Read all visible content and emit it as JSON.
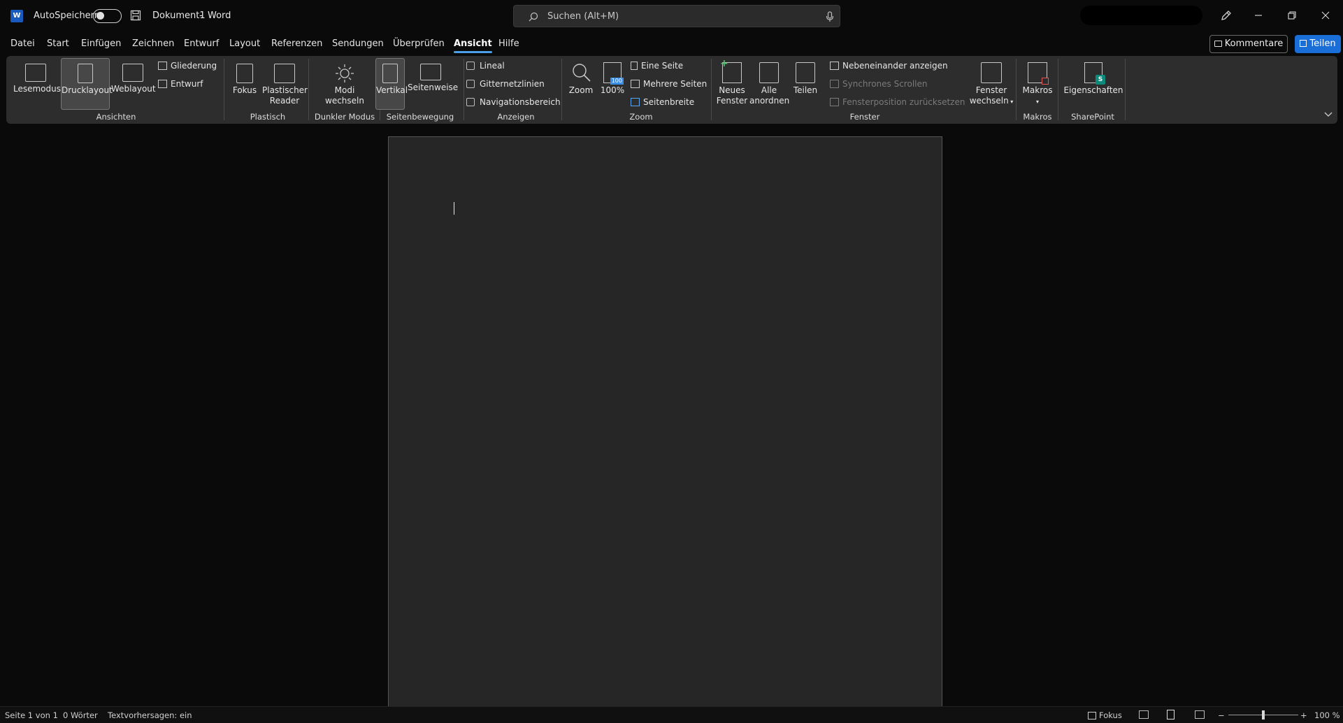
{
  "titlebar": {
    "autosave_label": "AutoSpeichern",
    "document_title": "Dokument1",
    "separator": "-",
    "app_name": "Word",
    "search_placeholder": "Suchen (Alt+M)",
    "app_icon_letter": "W"
  },
  "menu": {
    "items": [
      "Datei",
      "Start",
      "Einfügen",
      "Zeichnen",
      "Entwurf",
      "Layout",
      "Referenzen",
      "Sendungen",
      "Überprüfen",
      "Ansicht",
      "Hilfe"
    ],
    "active": "Ansicht",
    "comments_label": "Kommentare",
    "share_label": "Teilen"
  },
  "ribbon": {
    "ansichten": {
      "group": "Ansichten",
      "lesemodus": "Lesemodus",
      "drucklayout": "Drucklayout",
      "weblayout": "Weblayout",
      "gliederung": "Gliederung",
      "entwurf": "Entwurf"
    },
    "plastisch": {
      "group": "Plastisch",
      "fokus": "Fokus",
      "reader_line1": "Plastischer",
      "reader_line2": "Reader"
    },
    "dunkler": {
      "group": "Dunkler Modus",
      "line1": "Modi",
      "line2": "wechseln"
    },
    "seitenbewegung": {
      "group": "Seitenbewegung",
      "vertikal": "Vertikal",
      "seitenweise": "Seitenweise"
    },
    "anzeigen": {
      "group": "Anzeigen",
      "lineal": "Lineal",
      "gitternetzlinien": "Gitternetzlinien",
      "navigationsbereich": "Navigationsbereich"
    },
    "zoom": {
      "group": "Zoom",
      "zoom": "Zoom",
      "hundert": "100%",
      "eine_seite": "Eine Seite",
      "mehrere_seiten": "Mehrere Seiten",
      "seitenbreite": "Seitenbreite"
    },
    "fenster": {
      "group": "Fenster",
      "neues_line1": "Neues",
      "neues_line2": "Fenster",
      "alle_line1": "Alle",
      "alle_line2": "anordnen",
      "teilen": "Teilen",
      "nebeneinander": "Nebeneinander anzeigen",
      "synchron": "Synchrones Scrollen",
      "position": "Fensterposition zurücksetzen",
      "wechseln_line1": "Fenster",
      "wechseln_line2": "wechseln"
    },
    "makros": {
      "group": "Makros",
      "makros": "Makros"
    },
    "sharepoint": {
      "group": "SharePoint",
      "eigenschaften": "Eigenschaften"
    }
  },
  "statusbar": {
    "page": "Seite 1 von 1",
    "words": "0 Wörter",
    "predictions": "Textvorhersagen: ein",
    "focus": "Fokus",
    "zoom_level": "100 %",
    "zoom_minus": "−",
    "zoom_plus": "+",
    "zoom_fraction": 0.5
  },
  "colors": {
    "accent": "#1a6ed8",
    "word_blue": "#185abd",
    "background": "#0a0a0a",
    "ribbon": "#2d2d2d",
    "page": "#262626"
  }
}
